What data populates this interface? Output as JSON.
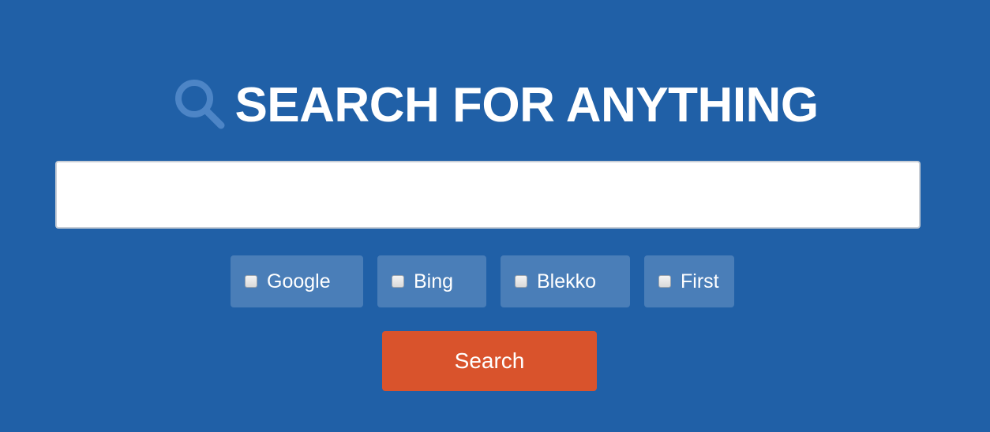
{
  "header": {
    "icon": "search-icon",
    "title": "SEARCH FOR ANYTHING"
  },
  "search": {
    "value": "",
    "placeholder": ""
  },
  "engines": [
    {
      "label": "Google",
      "checked": false
    },
    {
      "label": "Bing",
      "checked": false
    },
    {
      "label": "Blekko",
      "checked": false
    },
    {
      "label": "First",
      "checked": false
    }
  ],
  "actions": {
    "search_label": "Search"
  },
  "colors": {
    "background": "#2060a7",
    "option_background": "#4a7eb8",
    "button": "#d9532c",
    "text": "#ffffff"
  }
}
